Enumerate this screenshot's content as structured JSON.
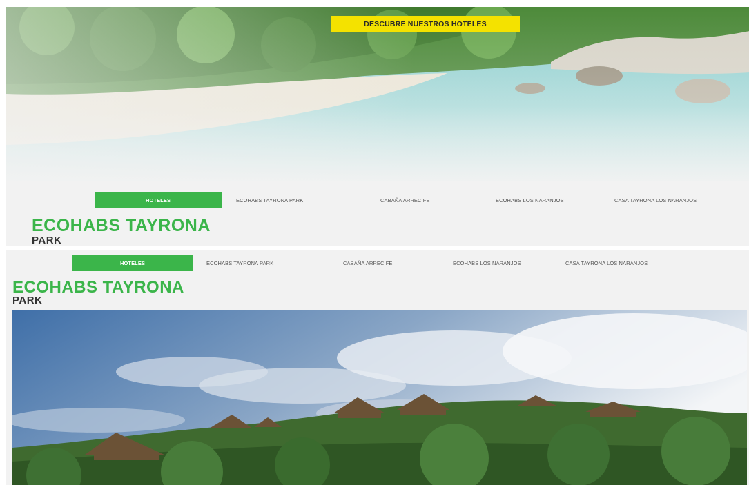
{
  "hero": {
    "badge": "DESCUBRE NUESTROS HOTELES",
    "image": "tropical-beach-photo"
  },
  "nav_top": {
    "items": [
      {
        "label": "HOTELES",
        "active": true
      },
      {
        "label": "ECOHABS TAYRONA PARK",
        "active": false
      },
      {
        "label": "CABAÑA ARRECIFE",
        "active": false
      },
      {
        "label": "ECOHABS LOS NARANJOS",
        "active": false
      },
      {
        "label": "CASA TAYRONA LOS NARANJOS",
        "active": false
      }
    ]
  },
  "heading_top": {
    "title": "ECOHABS TAYRONA",
    "subtitle": "PARK"
  },
  "nav_bottom": {
    "items": [
      {
        "label": "HOTELES",
        "active": true
      },
      {
        "label": "ECOHABS TAYRONA PARK",
        "active": false
      },
      {
        "label": "CABAÑA ARRECIFE",
        "active": false
      },
      {
        "label": "ECOHABS LOS NARANJOS",
        "active": false
      },
      {
        "label": "CASA TAYRONA LOS NARANJOS",
        "active": false
      }
    ]
  },
  "heading_bottom": {
    "title": "ECOHABS TAYRONA",
    "subtitle": "PARK"
  },
  "photo": {
    "image": "ecohabs-huts-on-hill-photo"
  },
  "colors": {
    "accent_green": "#3bb54a",
    "badge_yellow": "#f4e200",
    "panel_gray": "#f2f2f2"
  }
}
